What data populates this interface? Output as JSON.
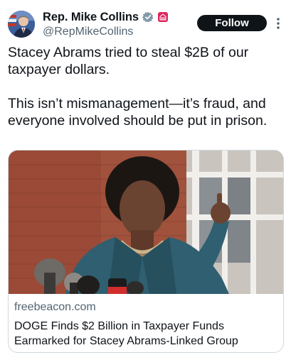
{
  "author": {
    "display_name": "Rep. Mike Collins",
    "handle": "@RepMikeCollins",
    "verified_icon": "verified-badge-icon",
    "affiliation_icon": "us-government-badge-icon"
  },
  "actions": {
    "follow_label": "Follow",
    "more_icon": "more-options-icon"
  },
  "tweet": {
    "line1": "Stacey Abrams tried to steal $2B of our taxpayer dollars.",
    "line2": "This isn’t mismanagement—it’s fraud, and everyone involved should be put in prison."
  },
  "card": {
    "domain": "freebeacon.com",
    "title": "DOGE Finds $2 Billion in Taxpayer Funds Earmarked for Stacey Abrams-Linked Group",
    "image": "photo-woman-speaking-at-microphones"
  },
  "colors": {
    "text": "#0f1419",
    "secondary": "#536471",
    "border": "#cfd9de",
    "follow_bg": "#0f1419",
    "verified": "#829aab",
    "gov_badge": "#e0245e"
  }
}
